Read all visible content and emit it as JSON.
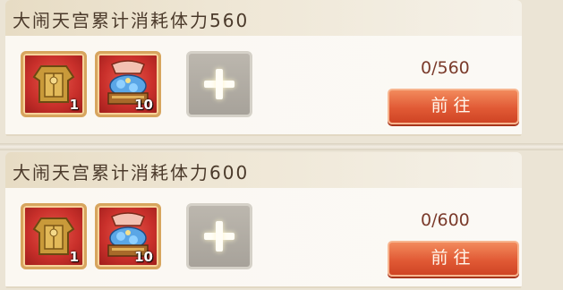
{
  "tasks": [
    {
      "title": "大闹天宫累计消耗体力560",
      "rewards": [
        {
          "icon": "armor-chest-icon",
          "count": "1"
        },
        {
          "icon": "treasure-box-icon",
          "count": "10"
        }
      ],
      "add_icon": "plus-icon",
      "progress": "0/560",
      "button_label": "前往"
    },
    {
      "title": "大闹天宫累计消耗体力600",
      "rewards": [
        {
          "icon": "armor-chest-icon",
          "count": "1"
        },
        {
          "icon": "treasure-box-icon",
          "count": "10"
        }
      ],
      "add_icon": "plus-icon",
      "progress": "0/600",
      "button_label": "前往"
    }
  ],
  "colors": {
    "button": "#e15a35",
    "slot_red": "#c9302b",
    "title_text": "#4b3a2b",
    "progress_text": "#7a3a2a"
  }
}
